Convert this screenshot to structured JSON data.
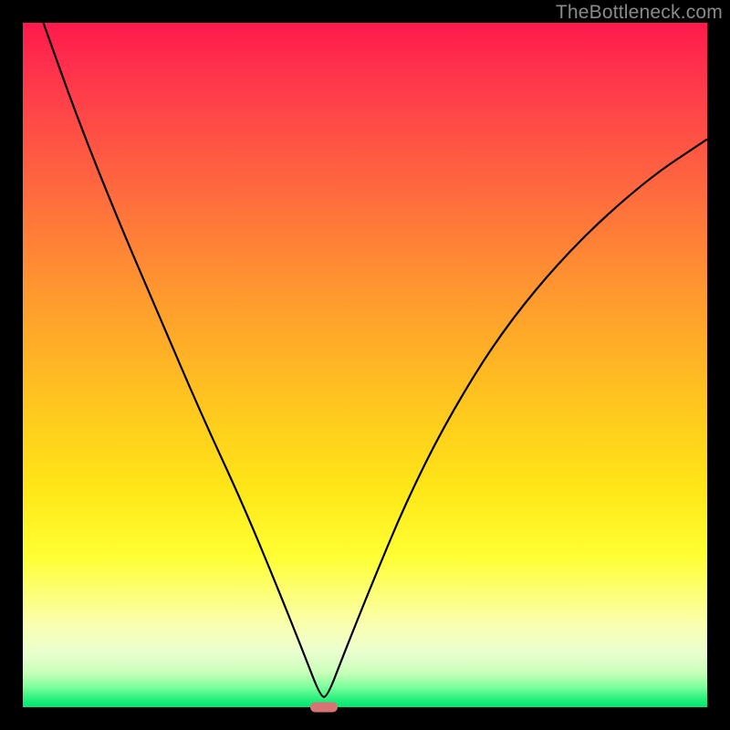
{
  "watermark": "TheBottleneck.com",
  "marker_x_percent": 44,
  "chart_data": {
    "type": "line",
    "title": "",
    "xlabel": "",
    "ylabel": "",
    "xlim": [
      0,
      100
    ],
    "ylim": [
      0,
      100
    ],
    "grid": false,
    "series": [
      {
        "name": "bottleneck-curve",
        "x": [
          3,
          8,
          14,
          20,
          26,
          32,
          37,
          41,
          43.5,
          44.5,
          47,
          51,
          56,
          62,
          70,
          80,
          91,
          100
        ],
        "y": [
          100,
          86,
          71,
          57,
          43,
          30,
          18,
          8,
          1.5,
          1.5,
          8,
          18,
          30,
          42,
          55,
          67,
          77,
          83
        ]
      }
    ],
    "background_gradient": {
      "stops": [
        {
          "pos": 0,
          "color": "#ff1a4d"
        },
        {
          "pos": 25,
          "color": "#ff6b3e"
        },
        {
          "pos": 55,
          "color": "#ffc41f"
        },
        {
          "pos": 78,
          "color": "#ffff33"
        },
        {
          "pos": 95,
          "color": "#c8ffb8"
        },
        {
          "pos": 100,
          "color": "#00e574"
        }
      ]
    },
    "marker": {
      "x_percent": 44,
      "color": "#d87373"
    }
  }
}
